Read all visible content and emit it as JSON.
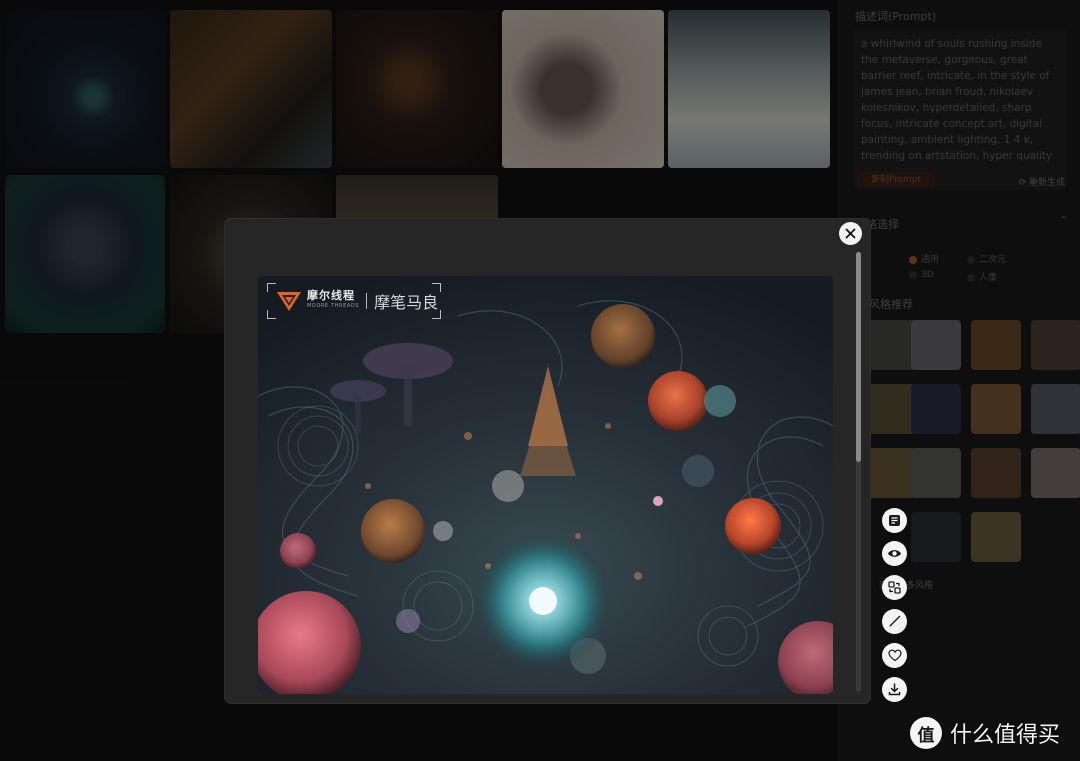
{
  "panel": {
    "prompt_title": "描述词(Prompt)",
    "prompt_text": "a whirlwind of souls rushing inside the metaverse, gorgeous, great barrier reef, intricate, in the style of james jean, brian froud, nikolaev kolesnikov, hyperdetailed, sharp focus, intricate concept art, digital painting, ambient lighting, 1 4 k, trending on artstation, hyper quality",
    "copy_label": "复制Prompt",
    "regen_label": "重新生成",
    "style_title": "风格选择",
    "style_options": [
      "通用",
      "二次元",
      "3D",
      "人像"
    ],
    "recommend_title": "风格推荐",
    "more_label": "查看更多风格"
  },
  "modal": {
    "watermark_title": "摩尔线程",
    "watermark_sub": "MOORE THREADS",
    "watermark_name": "摩笔马良",
    "tools": [
      "prompt-icon",
      "eye-icon",
      "image-variation-icon",
      "brush-icon",
      "heart-icon",
      "download-icon"
    ]
  },
  "brand": {
    "badge": "值",
    "text": "什么值得买"
  },
  "colors": {
    "accent": "#b45a2a",
    "brand_red": "#e22c2c"
  }
}
